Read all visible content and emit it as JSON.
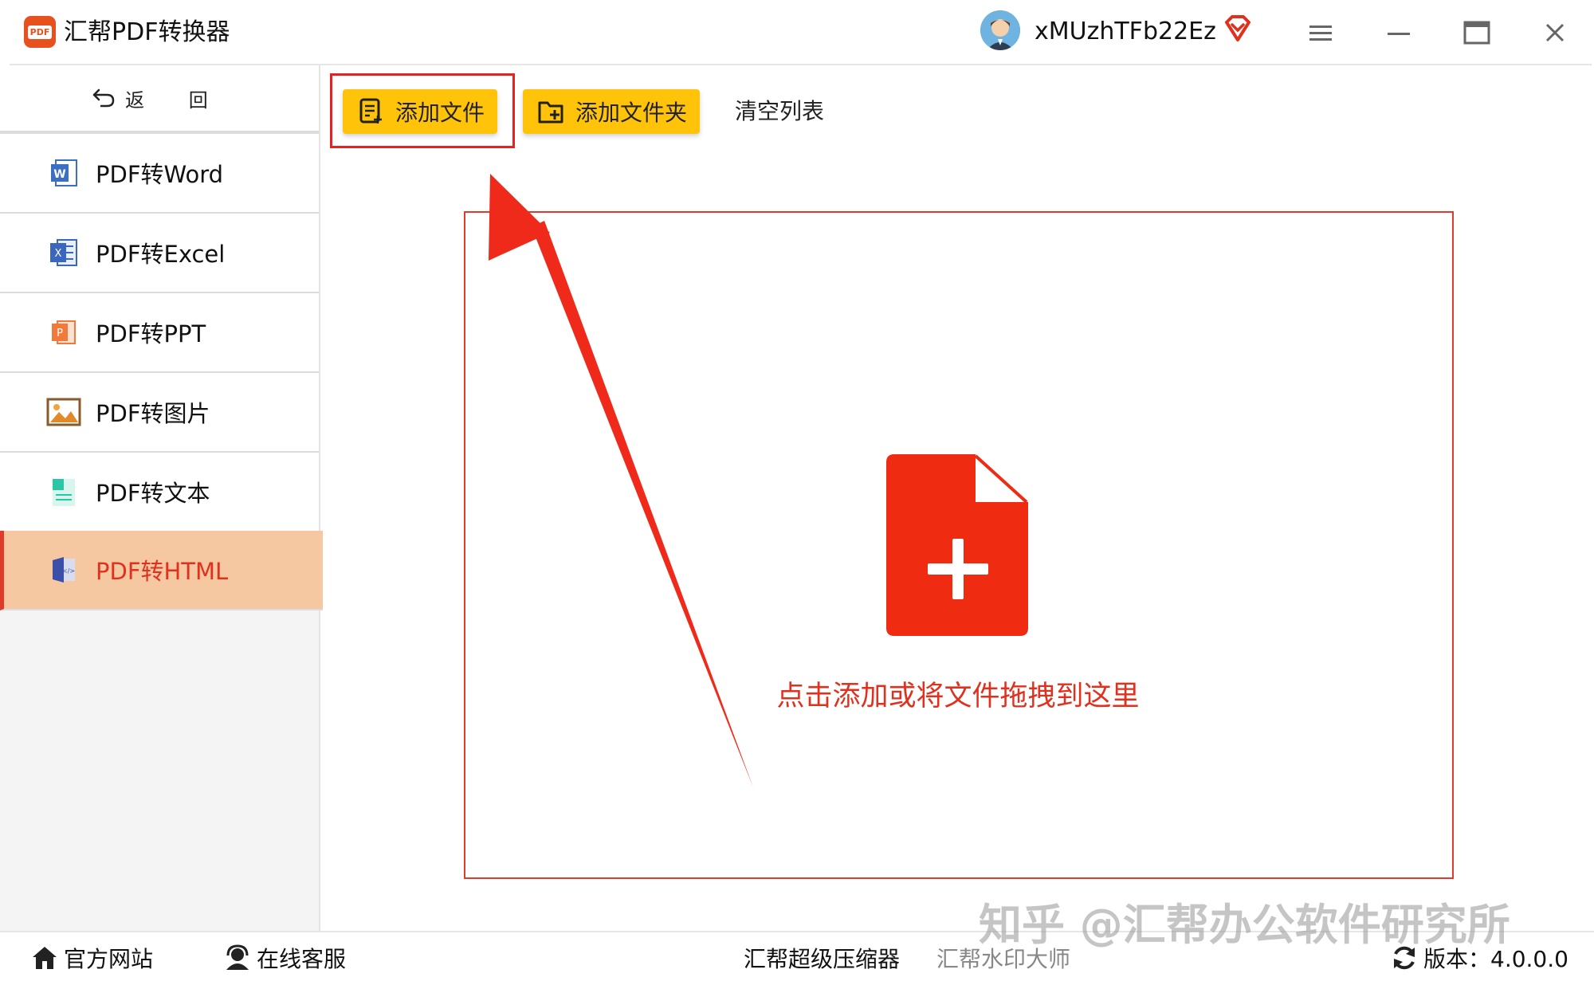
{
  "app": {
    "title": "汇帮PDF转换器",
    "logo_text": "PDF",
    "username": "xMUzhTFb22Ez"
  },
  "window_controls": [
    "menu-icon",
    "minimize-icon",
    "maximize-icon",
    "close-icon"
  ],
  "sidebar": {
    "back_label": "返 回",
    "items": [
      {
        "label": "PDF转Word",
        "icon": "word-icon",
        "icon_letter": "W",
        "color": "#3b6fc4",
        "active": false
      },
      {
        "label": "PDF转Excel",
        "icon": "excel-icon",
        "icon_letter": "X",
        "color": "#3a66c0",
        "active": false
      },
      {
        "label": "PDF转PPT",
        "icon": "ppt-icon",
        "icon_letter": "P",
        "color": "#f07a3c",
        "active": false
      },
      {
        "label": "PDF转图片",
        "icon": "image-icon",
        "icon_letter": "",
        "color": "#e28a2a",
        "active": false
      },
      {
        "label": "PDF转文本",
        "icon": "text-icon",
        "icon_letter": "",
        "color": "#28c7a5",
        "active": false
      },
      {
        "label": "PDF转HTML",
        "icon": "html-icon",
        "icon_letter": "",
        "color": "#3b4fa8",
        "active": true
      }
    ]
  },
  "toolbar": {
    "add_file_label": "添加文件",
    "add_folder_label": "添加文件夹",
    "clear_label": "清空列表"
  },
  "dropzone": {
    "hint": "点击添加或将文件拖拽到这里"
  },
  "footer": {
    "website_label": "官方网站",
    "support_label": "在线客服",
    "compressor_label": "汇帮超级压缩器",
    "watermark_tool_label": "汇帮水印大师",
    "version_label": "版本：4.0.0.0"
  },
  "overlay": {
    "watermark": "知乎 @汇帮办公软件研究所"
  },
  "colors": {
    "accent_red": "#e0301e",
    "button_yellow": "#ffc40a",
    "active_bg": "#f6c8a2"
  }
}
